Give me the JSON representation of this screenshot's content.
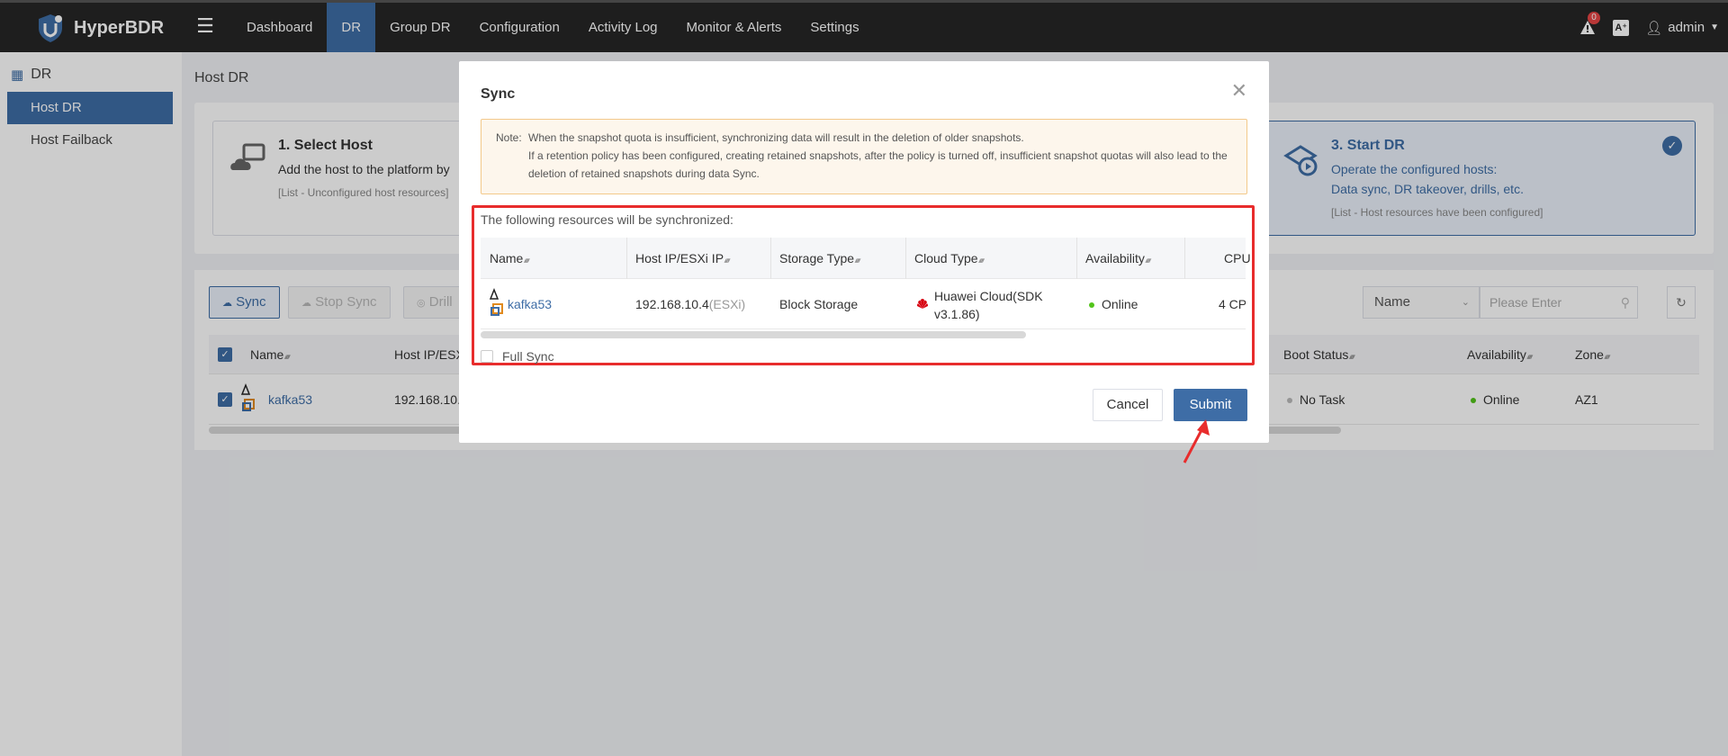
{
  "app": {
    "brand": "HyperBDR"
  },
  "nav": {
    "items": [
      {
        "label": "Dashboard"
      },
      {
        "label": "DR"
      },
      {
        "label": "Group DR"
      },
      {
        "label": "Configuration"
      },
      {
        "label": "Activity Log"
      },
      {
        "label": "Monitor & Alerts"
      },
      {
        "label": "Settings"
      }
    ],
    "active": "DR",
    "alert_count": "0",
    "user": "admin"
  },
  "sidebar": {
    "title": "DR",
    "items": [
      {
        "label": "Host DR"
      },
      {
        "label": "Host Failback"
      }
    ]
  },
  "page": {
    "title": "Host DR",
    "steps": [
      {
        "title": "1. Select Host",
        "desc": "Add the host to the platform by",
        "sub": "[List - Unconfigured host resources]"
      },
      {
        "title": "3. Start DR",
        "desc1": "Operate the configured hosts:",
        "desc2": "Data sync, DR takeover, drills, etc.",
        "sub": "[List - Host resources have been configured]"
      }
    ]
  },
  "toolbar": {
    "sync": "Sync",
    "stop_sync": "Stop Sync",
    "drill": "Drill",
    "search_field": "Name",
    "search_placeholder": "Please Enter"
  },
  "host_table": {
    "columns": [
      "Name",
      "Host IP/ESX",
      "Boot Status",
      "Availability",
      "Zone"
    ],
    "rows": [
      {
        "name": "kafka53",
        "ip": "192.168.10.",
        "boot_status": "No Task",
        "availability": "Online",
        "zone": "AZ1"
      }
    ]
  },
  "modal": {
    "title": "Sync",
    "note_label": "Note:",
    "note_lines": [
      "When the snapshot quota is insufficient, synchronizing data will result in the deletion of older snapshots.",
      "If a retention policy has been configured, creating retained snapshots, after the policy is turned off, insufficient snapshot quotas will also lead to the deletion of retained snapshots during data Sync."
    ],
    "resources_label": "The following resources will be synchronized:",
    "columns": [
      "Name",
      "Host IP/ESXi IP",
      "Storage Type",
      "Cloud Type",
      "Availability",
      "CPU"
    ],
    "rows": [
      {
        "name": "kafka53",
        "ip": "192.168.10.4",
        "ip_suffix": "(ESXi)",
        "storage": "Block Storage",
        "cloud_line1": "Huawei Cloud(SDK",
        "cloud_line2": "v3.1.86)",
        "availability": "Online",
        "cpu": "4 CP"
      }
    ],
    "full_sync": "Full Sync",
    "cancel": "Cancel",
    "submit": "Submit"
  },
  "colors": {
    "nav_bg": "#262626",
    "accent": "#3e6da6",
    "online": "#52c41a",
    "highlight": "#e82c2c",
    "huawei": "#d7000f"
  }
}
